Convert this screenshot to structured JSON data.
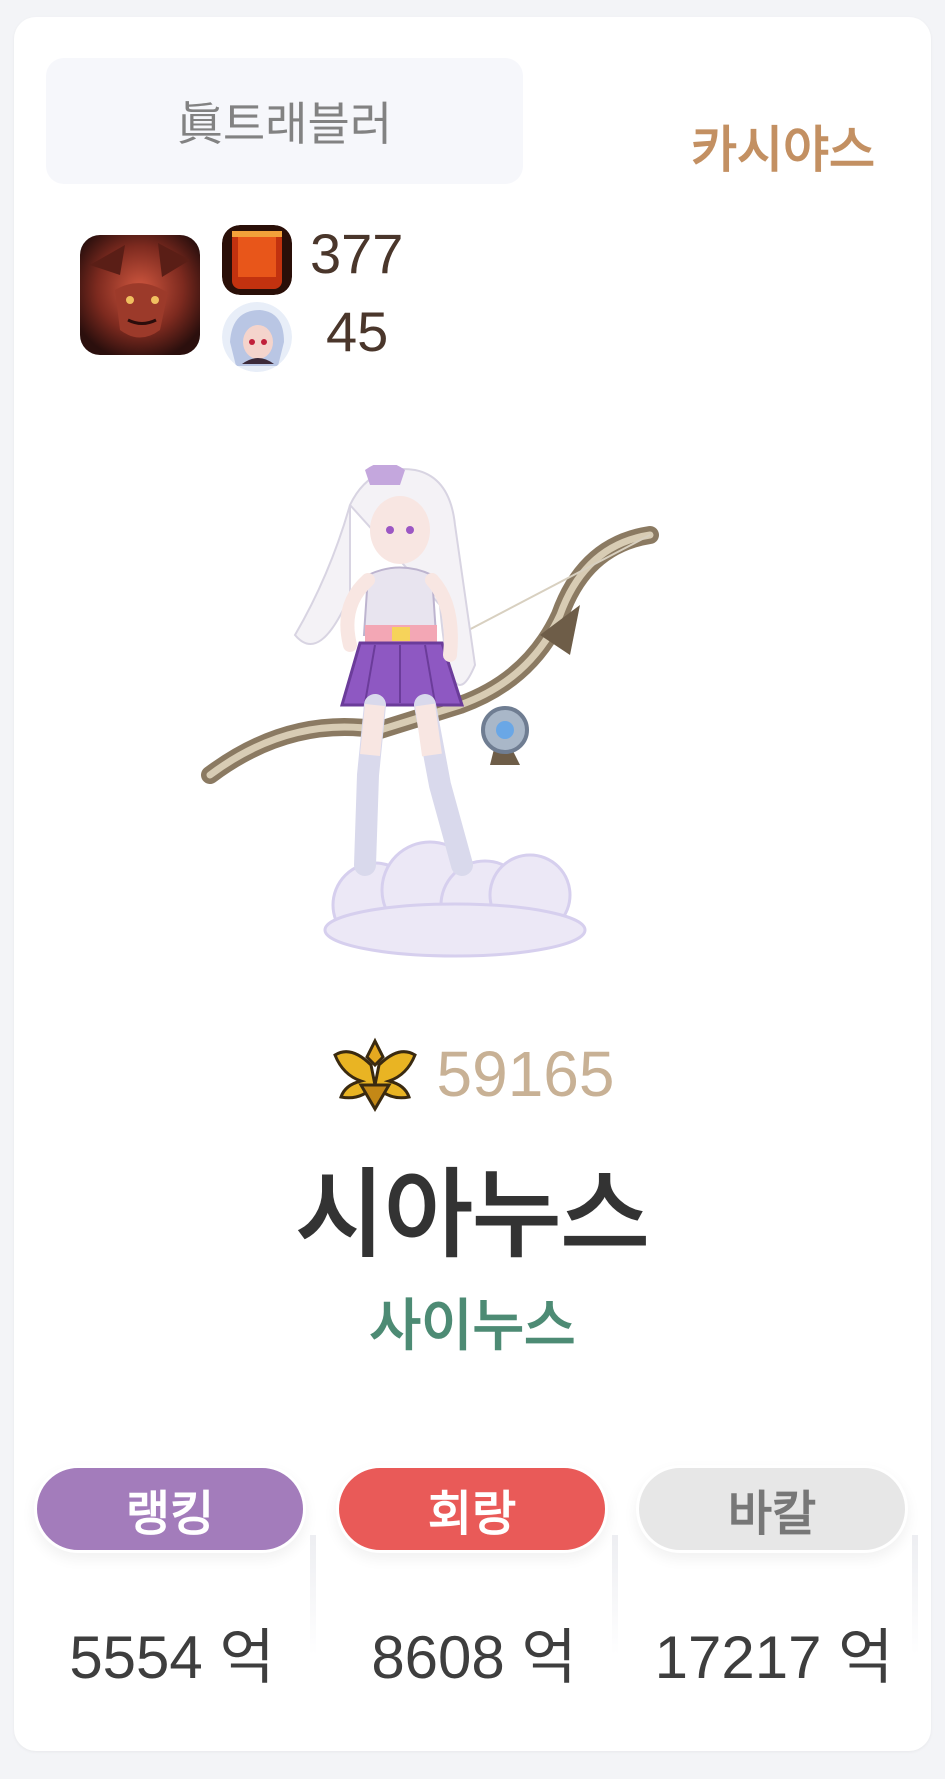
{
  "header": {
    "class_name": "眞트래블러",
    "server": "카시야스"
  },
  "stats": {
    "avatar_icon": "demon-portrait-icon",
    "primary_icon": "red-banner-icon",
    "primary_value": "377",
    "secondary_icon": "character-portrait-icon",
    "secondary_value": "45"
  },
  "character": {
    "sprite": "archer-character-sprite",
    "fame_icon": "gold-wings-emblem-icon",
    "fame": "59165",
    "name": "시아누스",
    "guild": "사이누스"
  },
  "tabs": [
    {
      "label": "랭킹",
      "amount": "5554 억",
      "color": "#a37cbb"
    },
    {
      "label": "회랑",
      "amount": "8608 억",
      "color": "#e95a58"
    },
    {
      "label": "바칼",
      "amount": "17217 억",
      "color": "#e7e7e7"
    }
  ]
}
